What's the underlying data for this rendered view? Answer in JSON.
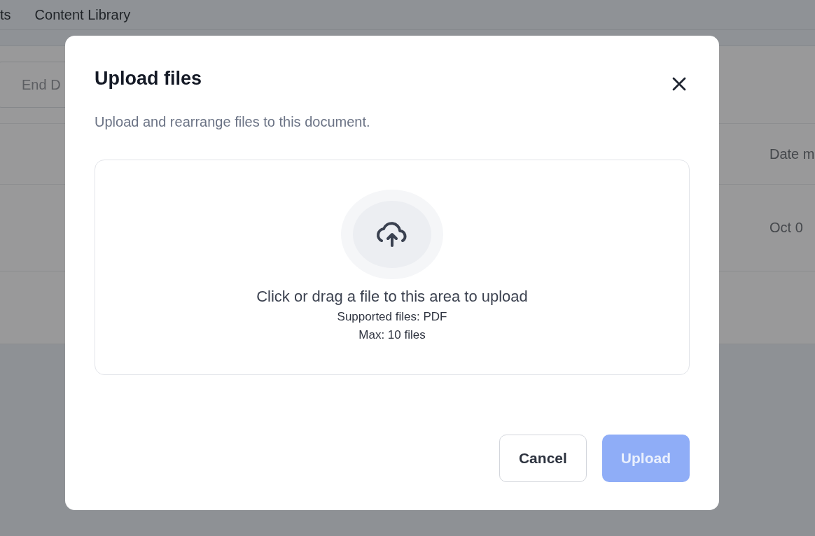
{
  "nav": {
    "items": [
      {
        "label": "ts"
      },
      {
        "label": "Content Library"
      }
    ]
  },
  "filters": {
    "end_date": {
      "placeholder": "End D"
    }
  },
  "table": {
    "columns": [
      {
        "label": "Date m"
      }
    ],
    "rows": [
      {
        "cells": [
          "Oct 0"
        ]
      }
    ]
  },
  "dialog": {
    "title": "Upload files",
    "subtitle": "Upload and rearrange files to this document.",
    "dropzone": {
      "prompt": "Click or drag a file to this area to upload",
      "supported": "Supported files: PDF",
      "max": "Max: 10 files"
    },
    "buttons": [
      {
        "label": "Cancel",
        "kind": "secondary",
        "disabled": false
      },
      {
        "label": "Upload",
        "kind": "primary",
        "disabled": true
      }
    ]
  }
}
